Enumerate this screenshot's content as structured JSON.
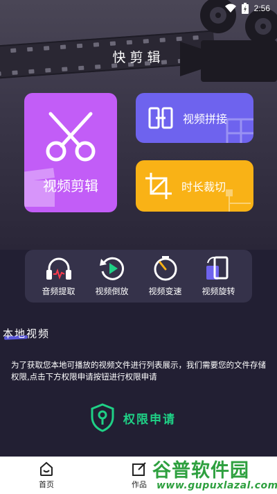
{
  "status_bar": {
    "time": "2:56",
    "icons": [
      "wifi-icon",
      "battery-icon"
    ]
  },
  "app": {
    "title": "快剪辑"
  },
  "main_cards": {
    "video_edit": {
      "label": "视频剪辑",
      "icon": "scissors-icon",
      "color": "#c25df7"
    },
    "video_concat": {
      "label": "视频拼接",
      "icon": "concat-icon",
      "color": "#6e63ee"
    },
    "duration_cut": {
      "label": "时长裁切",
      "icon": "crop-icon",
      "color": "#f9b216"
    }
  },
  "tools": [
    {
      "label": "音频提取",
      "icon": "headphones-icon"
    },
    {
      "label": "视频倒放",
      "icon": "reverse-play-icon"
    },
    {
      "label": "视频变速",
      "icon": "speedometer-icon"
    },
    {
      "label": "视频旋转",
      "icon": "rotate-icon"
    }
  ],
  "local_video": {
    "title": "本地视频",
    "permission_text": "为了获取您本地可播放的视频文件进行列表展示，我们需要您的文件存储权限,点击下方权限申请按钮进行权限申请",
    "permission_button": "权限申请",
    "accent": "#1fd086"
  },
  "bottom_nav": [
    {
      "label": "首页",
      "icon": "home-icon"
    },
    {
      "label": "作品",
      "icon": "edit-icon"
    }
  ],
  "watermark": {
    "main": "谷普软件园",
    "sub": "www.gupuxlazal.com"
  }
}
